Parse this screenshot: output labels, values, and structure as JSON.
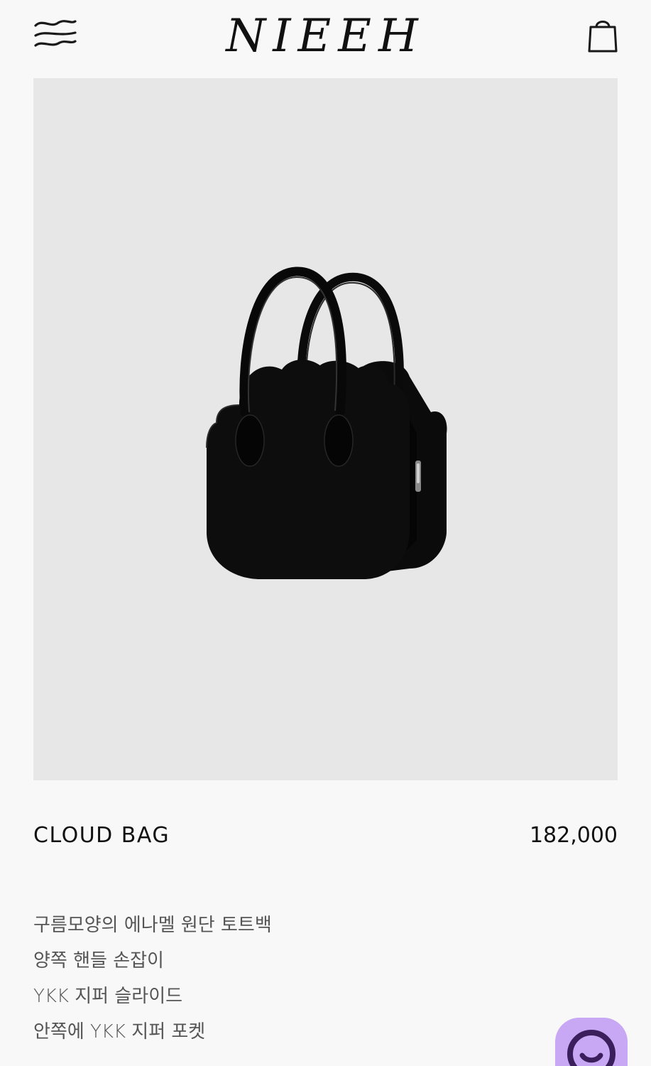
{
  "header": {
    "menu_icon": "hamburger-wave-icon",
    "logo": "NIEEH",
    "cart_icon": "shopping-bag-icon"
  },
  "product": {
    "name": "CLOUD BAG",
    "price": "182,000",
    "description": [
      "구름모양의 에나멜 원단 토트백",
      "양쪽 핸들 손잡이",
      "YKK 지퍼 슬라이드",
      "안쪽에 YKK 지퍼 포켓"
    ]
  },
  "chat": {
    "icon": "chat-smile-icon"
  },
  "colors": {
    "background": "#f8f8f8",
    "image_background": "#e7e7e7",
    "chat_accent": "#c8a8f4",
    "text": "#111111"
  }
}
